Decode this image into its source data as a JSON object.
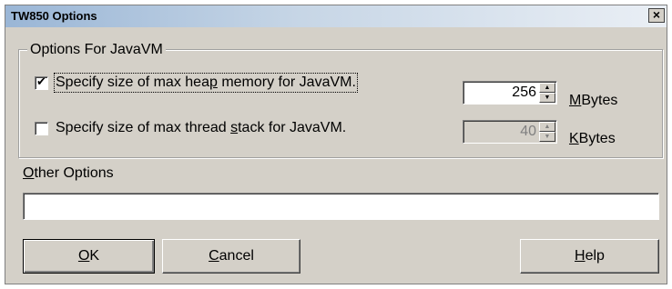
{
  "window": {
    "title": "TW850 Options",
    "close_glyph": "×"
  },
  "javavm_group": {
    "legend": "Options For JavaVM",
    "heap": {
      "checked": true,
      "label_pre": "Specify size of max hea",
      "label_accel": "p",
      "label_post": " memory for JavaVM.",
      "value": "256",
      "unit_accel": "M",
      "unit_rest": "Bytes",
      "enabled": true
    },
    "thread": {
      "checked": false,
      "label_pre": "Specify size of max thread ",
      "label_accel": "s",
      "label_post": "tack for JavaVM.",
      "value": "40",
      "unit_accel": "K",
      "unit_rest": "Bytes",
      "enabled": false
    }
  },
  "other_options": {
    "label_accel": "O",
    "label_rest": "ther Options",
    "value": ""
  },
  "buttons": {
    "ok_accel": "O",
    "ok_rest": "K",
    "cancel_accel": "C",
    "cancel_rest": "ancel",
    "help_accel": "H",
    "help_rest": "elp"
  }
}
